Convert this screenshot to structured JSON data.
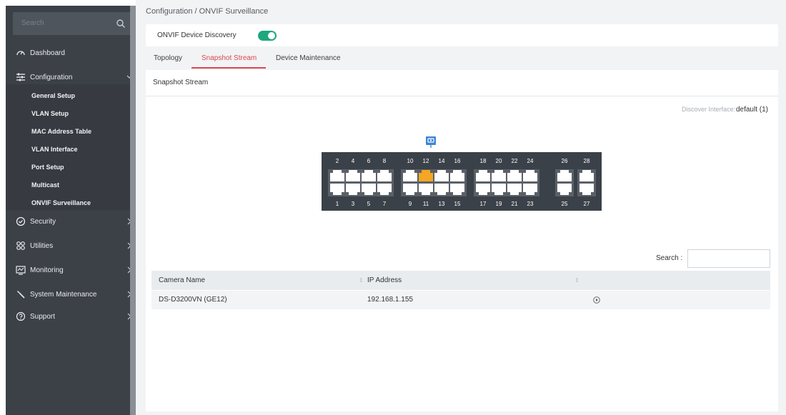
{
  "sidebar": {
    "search_placeholder": "Search",
    "items": [
      {
        "label": "Dashboard",
        "icon": "dashboard-icon"
      },
      {
        "label": "Configuration",
        "icon": "configuration-icon"
      },
      {
        "label": "Security",
        "icon": "security-icon"
      },
      {
        "label": "Utilities",
        "icon": "utilities-icon"
      },
      {
        "label": "Monitoring",
        "icon": "monitoring-icon"
      },
      {
        "label": "System Maintenance",
        "icon": "wrench-icon"
      },
      {
        "label": "Support",
        "icon": "support-icon"
      }
    ],
    "config_subitems": [
      "General Setup",
      "VLAN Setup",
      "MAC Address Table",
      "VLAN Interface",
      "Port Setup",
      "Multicast",
      "ONVIF Surveillance"
    ]
  },
  "breadcrumb": "Configuration /  ONVIF Surveillance",
  "discovery": {
    "label": "ONVIF Device Discovery",
    "enabled": true
  },
  "tabs": [
    "Topology",
    "Snapshot Stream",
    "Device Maintenance"
  ],
  "active_tab": "Snapshot Stream",
  "content": {
    "title": "Snapshot Stream",
    "discover_interface_label": "Discover Interface:",
    "discover_interface_value": "default (1)"
  },
  "switch": {
    "top_labels": [
      "2",
      "4",
      "6",
      "8",
      "10",
      "12",
      "14",
      "16",
      "18",
      "20",
      "22",
      "24",
      "26",
      "28"
    ],
    "bottom_labels": [
      "1",
      "3",
      "5",
      "7",
      "9",
      "11",
      "13",
      "15",
      "17",
      "19",
      "21",
      "23",
      "25",
      "27"
    ],
    "active_port": "12",
    "colors": {
      "body": "#3b4148",
      "port": "#ffffff",
      "active": "#f5a623",
      "marker": "#3d86d6"
    }
  },
  "table": {
    "search_label": "Search :",
    "search_value": "",
    "columns": [
      "Camera Name",
      "IP Address",
      ""
    ],
    "rows": [
      {
        "camera_name": "DS-D3200VN (GE12)",
        "ip": "192.168.1.155",
        "action_icon": "play-circle-icon"
      }
    ]
  },
  "colors": {
    "sidebar": "#3c4148",
    "accent": "#d9484f",
    "toggle": "#1fa77d"
  }
}
